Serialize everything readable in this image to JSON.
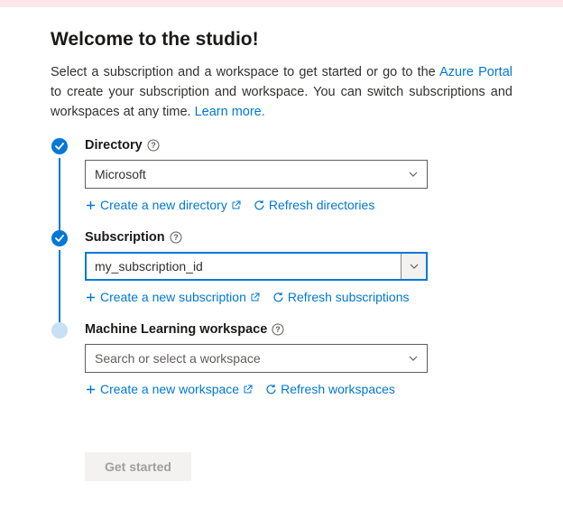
{
  "header": {
    "title": "Welcome to the studio!",
    "intro_before": "Select a subscription and a workspace to get started or go to the ",
    "azure_portal": "Azure Portal",
    "intro_mid": " to create your subscription and workspace. You can switch subscriptions and workspaces at any time. ",
    "learn_more": "Learn more."
  },
  "steps": {
    "directory": {
      "label": "Directory",
      "value": "Microsoft",
      "create": "Create a new directory",
      "refresh": "Refresh directories"
    },
    "subscription": {
      "label": "Subscription",
      "value": "my_subscription_id",
      "create": "Create a new subscription",
      "refresh": "Refresh subscriptions"
    },
    "workspace": {
      "label": "Machine Learning workspace",
      "placeholder": "Search or select a workspace",
      "create": "Create a new workspace",
      "refresh": "Refresh workspaces"
    }
  },
  "footer": {
    "button": "Get started"
  }
}
